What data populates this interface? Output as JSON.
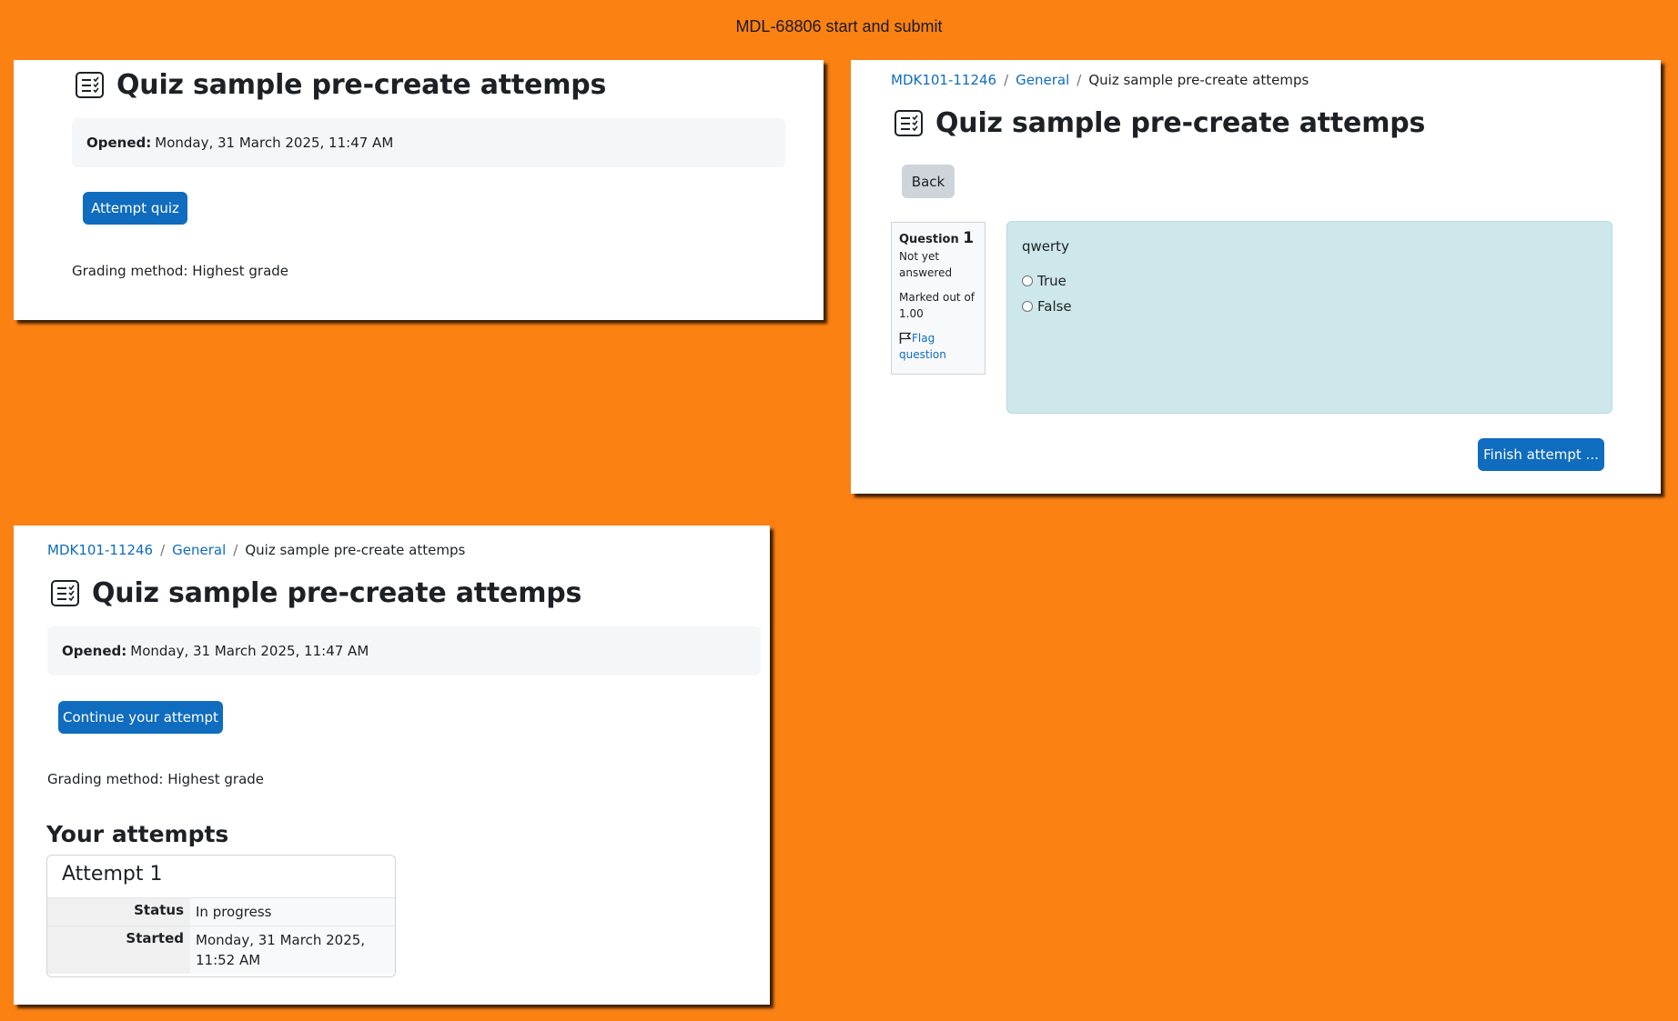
{
  "title": "MDL-68806 start and submit",
  "quiz_name": "Quiz sample pre-create attemps",
  "breadcrumb": {
    "course": "MDK101-11246",
    "section": "General",
    "separator": "/"
  },
  "info": {
    "opened_label": "Opened:",
    "opened_value": "Monday, 31 March 2025, 11:47 AM",
    "grading": "Grading method: Highest grade"
  },
  "panel_view": {
    "attempt_button": "Attempt quiz"
  },
  "panel_attempt": {
    "back_button": "Back",
    "question": {
      "label": "Question",
      "number": "1",
      "state": "Not yet answered",
      "marks": "Marked out of 1.00",
      "flag_label": "Flag question",
      "text": "qwerty",
      "options": [
        "True",
        "False"
      ]
    },
    "finish_button": "Finish attempt ..."
  },
  "panel_continue": {
    "continue_button": "Continue your attempt",
    "attempts_heading": "Your attempts",
    "attempt": {
      "title": "Attempt 1",
      "status_label": "Status",
      "status_value": "In progress",
      "started_label": "Started",
      "started_value": "Monday, 31 March 2025, 11:52 AM"
    }
  },
  "colors": {
    "background": "#fb8113",
    "primary": "#0f6cbf",
    "question_bg": "#cee7ea"
  }
}
